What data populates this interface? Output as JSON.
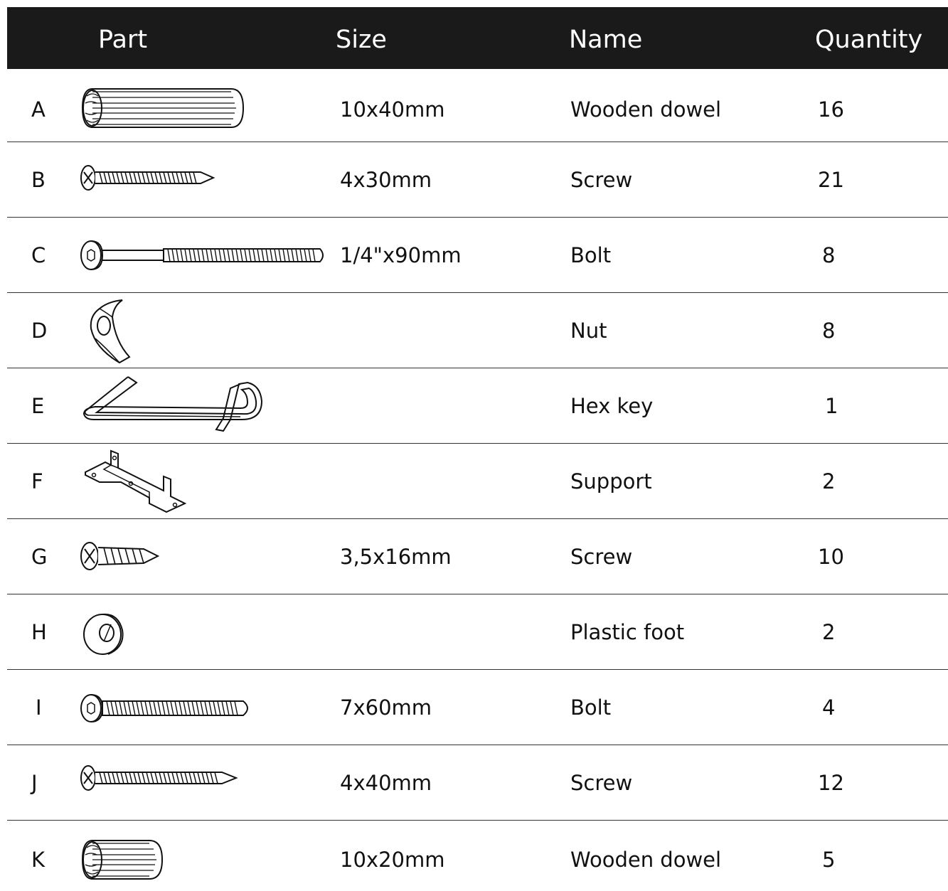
{
  "header": {
    "part": "Part",
    "size": "Size",
    "name": "Name",
    "quantity": "Quantity"
  },
  "rows": [
    {
      "letter": "A",
      "size": "10x40mm",
      "name": "Wooden dowel",
      "quantity": "16",
      "icon": "wooden-dowel-long-icon"
    },
    {
      "letter": "B",
      "size": "4x30mm",
      "name": "Screw",
      "quantity": "21",
      "icon": "screw-icon"
    },
    {
      "letter": "C",
      "size": "1/4\"x90mm",
      "name": "Bolt",
      "quantity": "8",
      "icon": "long-bolt-icon"
    },
    {
      "letter": "D",
      "size": "",
      "name": "Nut",
      "quantity": "8",
      "icon": "barrel-nut-icon"
    },
    {
      "letter": "E",
      "size": "",
      "name": "Hex key",
      "quantity": "1",
      "icon": "hex-key-icon"
    },
    {
      "letter": "F",
      "size": "",
      "name": "Support",
      "quantity": "2",
      "icon": "support-bracket-icon"
    },
    {
      "letter": "G",
      "size": "3,5x16mm",
      "name": "Screw",
      "quantity": "10",
      "icon": "short-screw-icon"
    },
    {
      "letter": "H",
      "size": "",
      "name": "Plastic foot",
      "quantity": "2",
      "icon": "plastic-foot-icon"
    },
    {
      "letter": "I",
      "size": "7x60mm",
      "name": "Bolt",
      "quantity": "4",
      "icon": "bolt-icon"
    },
    {
      "letter": "J",
      "size": "4x40mm",
      "name": "Screw",
      "quantity": "12",
      "icon": "long-screw-icon"
    },
    {
      "letter": "K",
      "size": "10x20mm",
      "name": "Wooden dowel",
      "quantity": "5",
      "icon": "wooden-dowel-short-icon"
    }
  ],
  "colors": {
    "header_bg": "#1a1a1a",
    "header_text": "#ffffff",
    "text": "#111111",
    "line": "#333333"
  }
}
